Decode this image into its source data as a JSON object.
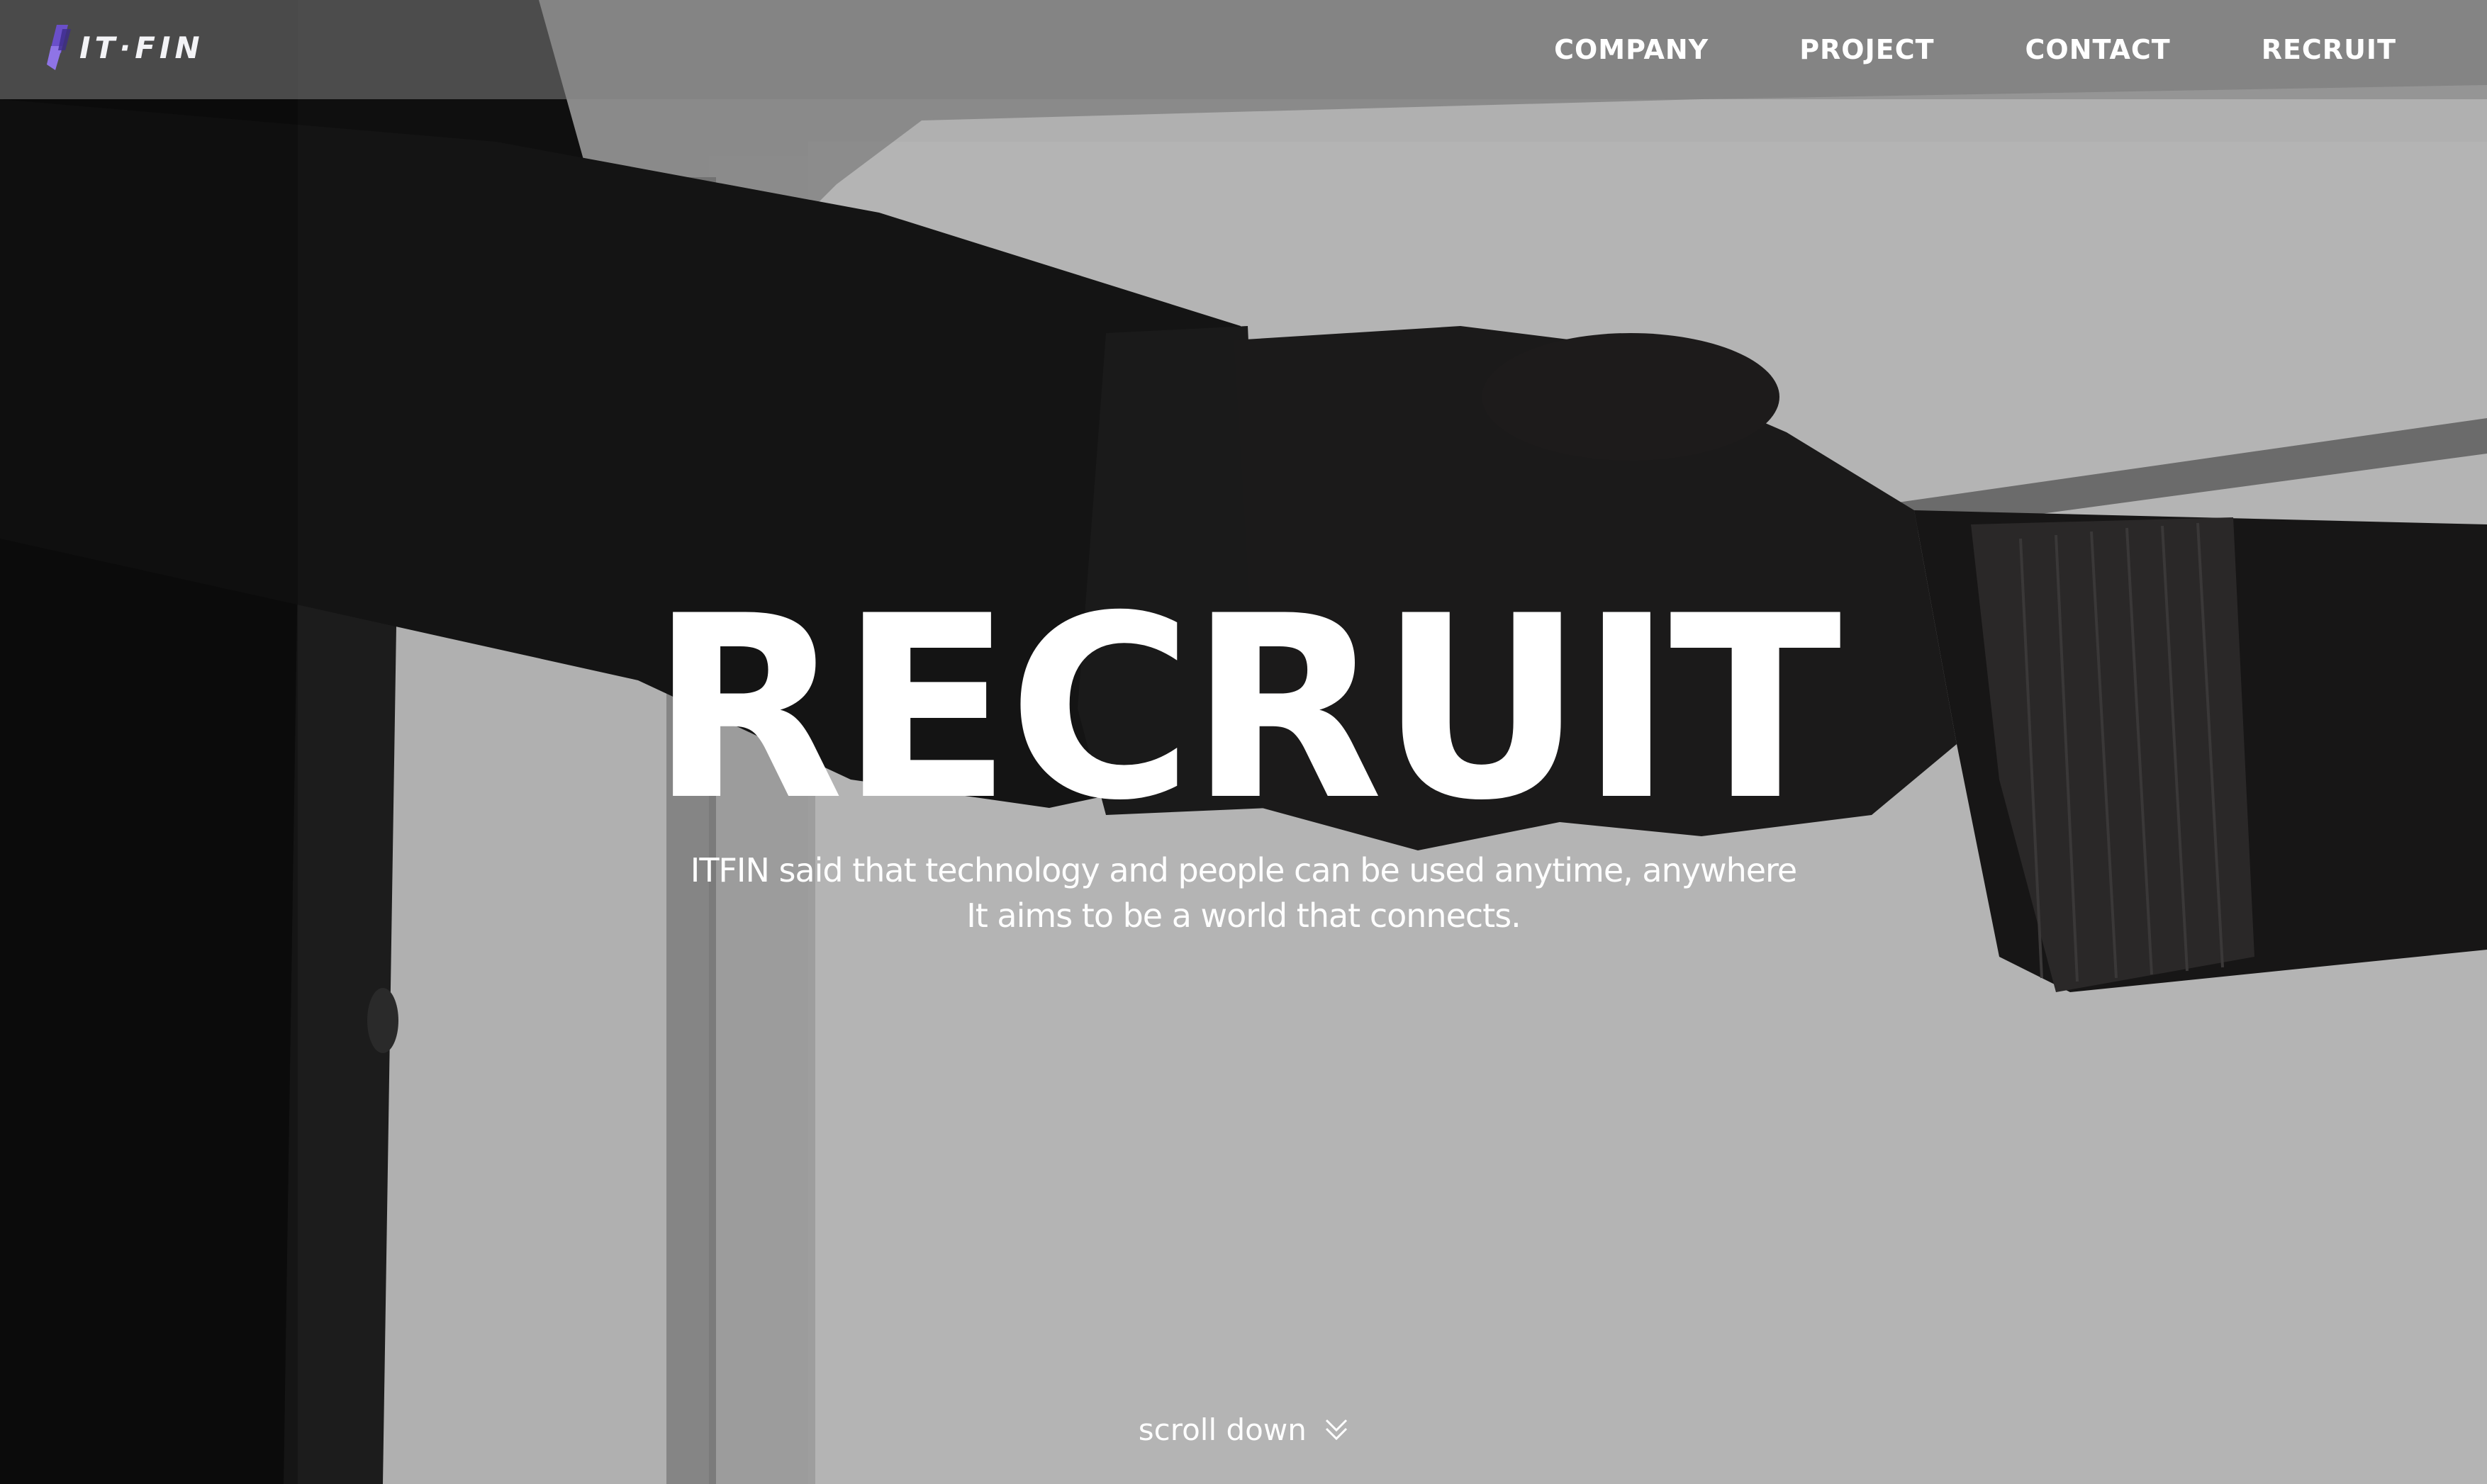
{
  "brand": {
    "logo_text": "IT·FIN",
    "accent": "#6a4fc9"
  },
  "nav": {
    "items": [
      "COMPANY",
      "PROJECT",
      "CONTACT",
      "RECRUIT"
    ]
  },
  "hero": {
    "title": "RECRUIT",
    "subtitle_line1": "ITFIN said that technology and people can be used anytime, anywhere",
    "subtitle_line2": "It aims to be a world that connects."
  },
  "scroll": {
    "label": "scroll down",
    "icon": "chevron-double-down-icon"
  }
}
